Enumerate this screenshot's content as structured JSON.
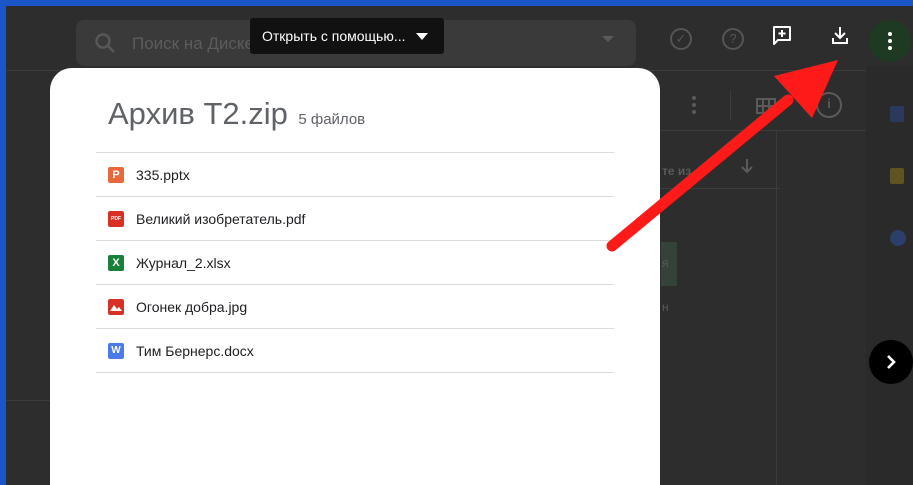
{
  "background": {
    "search_placeholder": "Поиск на Диске",
    "table_partial_header": "те из",
    "cell_partial_text": "я",
    "row_partial_text": "н"
  },
  "toolbar": {
    "open_with_label": "Открыть с помощью..."
  },
  "archive": {
    "name": "Архив T2.zip",
    "count_label": "5 файлов",
    "files": [
      {
        "name": "335.pptx",
        "type": "pptx",
        "icon_letter": "P",
        "color": "#e8673b"
      },
      {
        "name": "Великий изобретатель.pdf",
        "type": "pdf",
        "icon_letter": "PDF",
        "color": "#d93025"
      },
      {
        "name": "Журнал_2.xlsx",
        "type": "xlsx",
        "icon_letter": "X",
        "color": "#188038"
      },
      {
        "name": "Огонек добра.jpg",
        "type": "jpg",
        "icon_letter": "",
        "color": "#d93025"
      },
      {
        "name": "Тим Бернерс.docx",
        "type": "docx",
        "icon_letter": "W",
        "color": "#4a7be6"
      }
    ]
  },
  "colors": {
    "frame_border": "#1a56c8",
    "annotation_arrow": "#ff1a1a",
    "overlay": "#2d2d2d"
  }
}
